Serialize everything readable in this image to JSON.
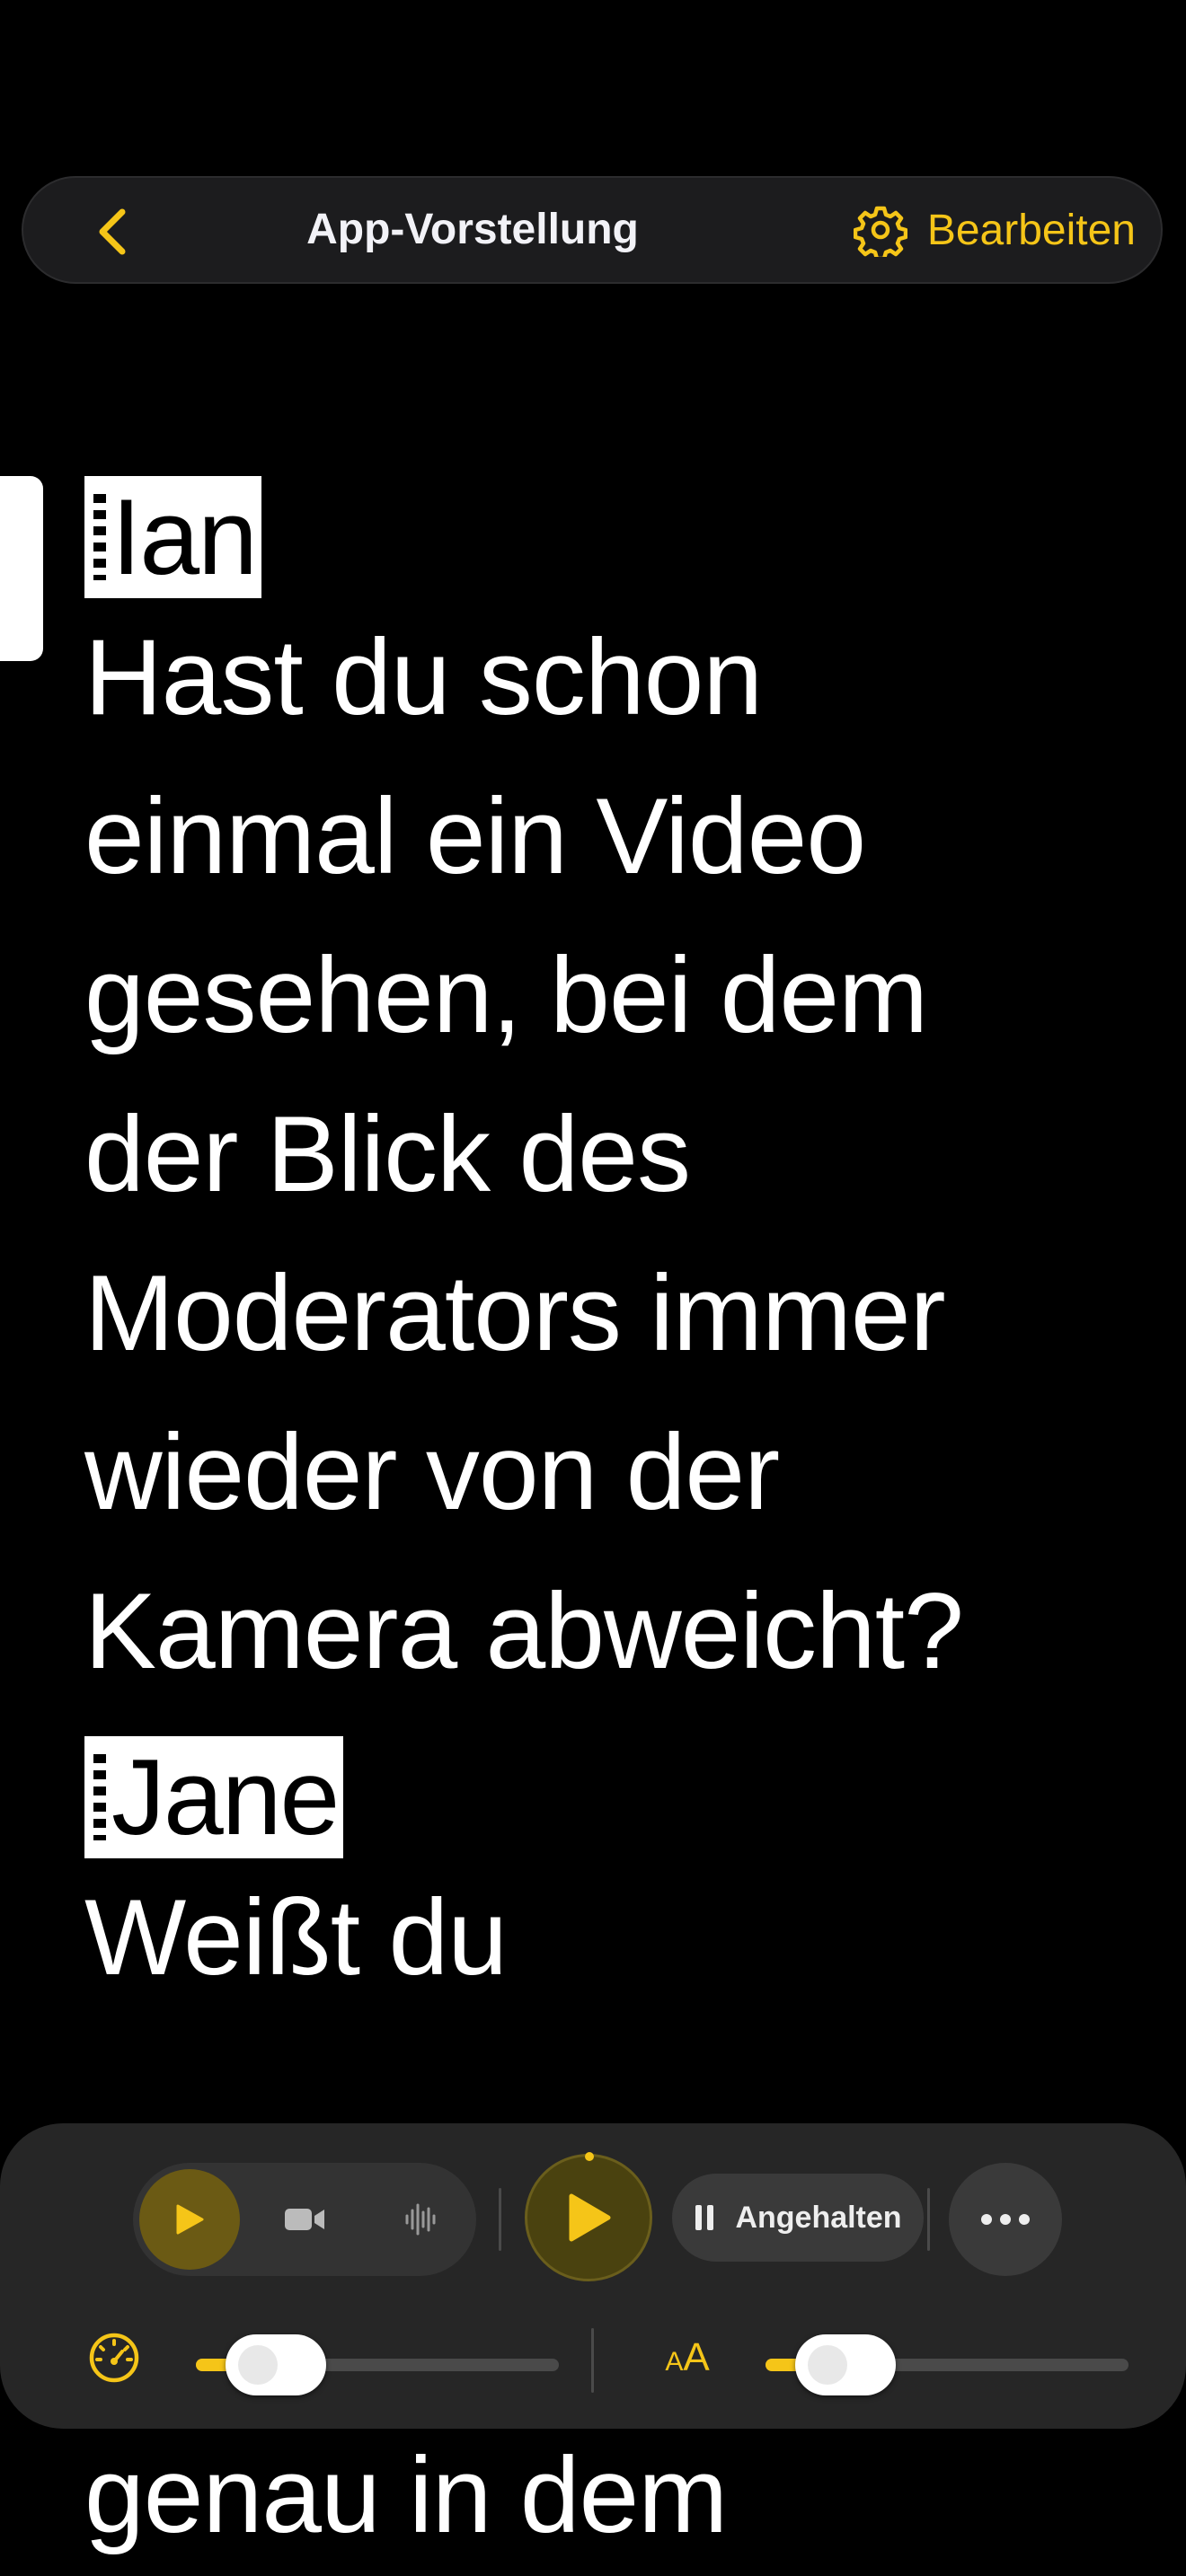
{
  "nav": {
    "back_icon": "chevron-left-icon",
    "title": "App-Vorstellung",
    "settings_icon": "gear-icon",
    "edit_label": "Bearbeiten"
  },
  "script": [
    {
      "speaker": "Ian",
      "lines": [
        "Hast du schon",
        "einmal ein Video",
        "gesehen, bei dem",
        "der Blick des",
        "Moderators immer",
        "wieder von der",
        "Kamera abweicht?"
      ]
    },
    {
      "speaker": "Jane",
      "lines": [
        "Weißt du"
      ]
    }
  ],
  "trailing_text": "genau in dem",
  "controls": {
    "modes": [
      {
        "name": "play-mode",
        "icon": "play-icon",
        "active": true
      },
      {
        "name": "video-mode",
        "icon": "video-camera-icon",
        "active": false
      },
      {
        "name": "audio-mode",
        "icon": "waveform-icon",
        "active": false
      }
    ],
    "main_play_icon": "play-icon",
    "status_icon": "pause-icon",
    "status_label": "Angehalten",
    "more_icon": "ellipsis-icon",
    "speed_icon": "speedometer-icon",
    "speed_level": 0.18,
    "text_size_label_big": "A",
    "text_size_label_small": "A",
    "text_size_level": 0.18
  },
  "colors": {
    "accent": "#f5c518",
    "background": "#000000",
    "panel": "#282828"
  }
}
